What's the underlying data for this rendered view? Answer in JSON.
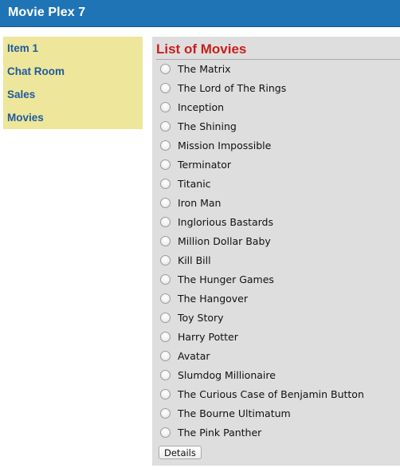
{
  "header": {
    "title": "Movie Plex 7",
    "background": "#1f74b6"
  },
  "sidebar": {
    "background": "#ede69b",
    "items": [
      {
        "label": "Item 1"
      },
      {
        "label": "Chat Room"
      },
      {
        "label": "Sales"
      },
      {
        "label": "Movies"
      }
    ]
  },
  "main": {
    "title": "List of Movies",
    "title_color": "#c9201c",
    "movies": [
      {
        "label": "The Matrix"
      },
      {
        "label": "The Lord of The Rings"
      },
      {
        "label": "Inception"
      },
      {
        "label": "The Shining"
      },
      {
        "label": "Mission Impossible"
      },
      {
        "label": "Terminator"
      },
      {
        "label": "Titanic"
      },
      {
        "label": "Iron Man"
      },
      {
        "label": "Inglorious Bastards"
      },
      {
        "label": "Million Dollar Baby"
      },
      {
        "label": "Kill Bill"
      },
      {
        "label": "The Hunger Games"
      },
      {
        "label": "The Hangover"
      },
      {
        "label": "Toy Story"
      },
      {
        "label": "Harry Potter"
      },
      {
        "label": "Avatar"
      },
      {
        "label": "Slumdog Millionaire"
      },
      {
        "label": "The Curious Case of Benjamin Button"
      },
      {
        "label": "The Bourne Ultimatum"
      },
      {
        "label": "The Pink Panther"
      }
    ],
    "details_label": "Details"
  }
}
